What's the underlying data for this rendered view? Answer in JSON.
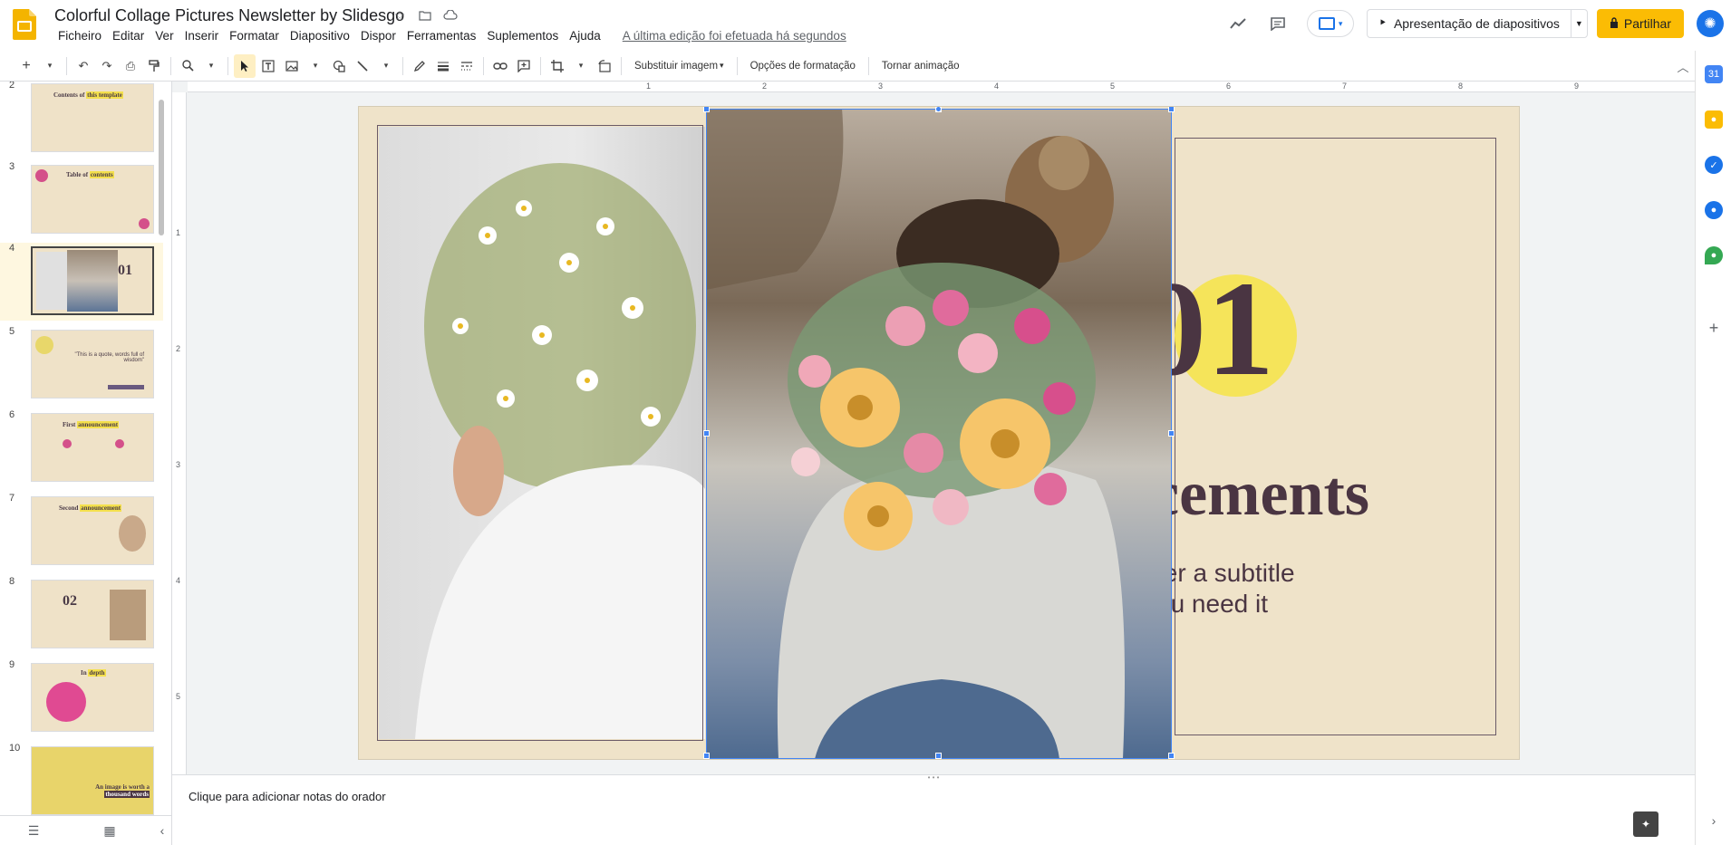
{
  "app": {
    "title": "Colorful Collage Pictures Newsletter by Slidesgo",
    "last_edit": "A última edição foi efetuada há segundos"
  },
  "menu": [
    "Ficheiro",
    "Editar",
    "Ver",
    "Inserir",
    "Formatar",
    "Diapositivo",
    "Dispor",
    "Ferramentas",
    "Suplementos",
    "Ajuda"
  ],
  "header": {
    "slideshow_label": "Apresentação de diapositivos",
    "share_label": "Partilhar"
  },
  "toolbar": {
    "replace_image": "Substituir imagem",
    "format_options": "Opções de formatação",
    "animate": "Tornar animação"
  },
  "ruler": {
    "h_marks": [
      "1",
      "2",
      "3",
      "4",
      "5",
      "6",
      "7",
      "8",
      "9"
    ],
    "v_marks": [
      "1",
      "2",
      "3",
      "4",
      "5"
    ]
  },
  "filmstrip": [
    {
      "num": "2",
      "text": "Contents of ",
      "hl": "this template"
    },
    {
      "num": "3",
      "text": "Table of ",
      "hl": "contents"
    },
    {
      "num": "4",
      "text": "01",
      "hl": "",
      "active": true
    },
    {
      "num": "5",
      "text": "\"This is a quote, words full of wisdom\"",
      "hl": ""
    },
    {
      "num": "6",
      "text": "First ",
      "hl": "announcement"
    },
    {
      "num": "7",
      "text": "Second ",
      "hl": "announcement"
    },
    {
      "num": "8",
      "text": "02",
      "hl": ""
    },
    {
      "num": "9",
      "text": "In ",
      "hl": "depth"
    },
    {
      "num": "10",
      "text": "An image is worth a ",
      "hl": "thousand words"
    }
  ],
  "slide": {
    "number": "01",
    "title_fragment": "cements",
    "subtitle_line1": "ter a subtitle",
    "subtitle_line2": "ou need it"
  },
  "notes": {
    "placeholder": "Clique para adicionar notas do orador"
  },
  "colors": {
    "accent": "#fbbc04",
    "selection": "#4285f4",
    "slide_bg": "#efe3c9",
    "title_color": "#4a3542",
    "highlight": "#f5e45a"
  }
}
